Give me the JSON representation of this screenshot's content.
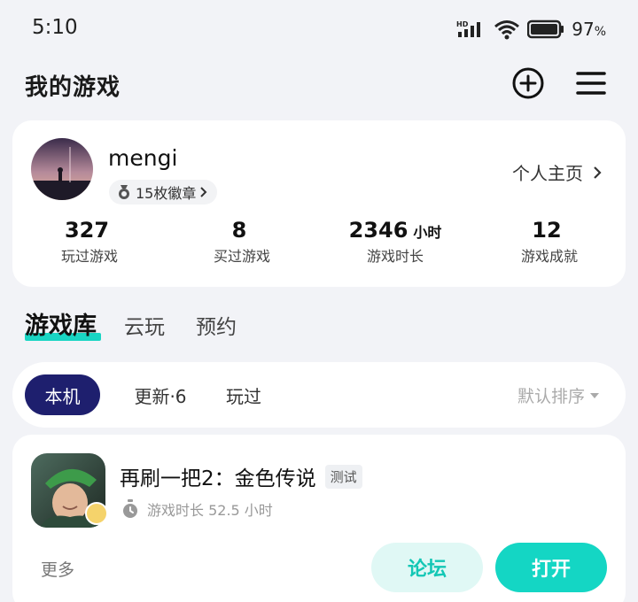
{
  "status_bar": {
    "time": "5:10",
    "network": "HD",
    "battery_percent": "97",
    "battery_unit": "%"
  },
  "header": {
    "title": "我的游戏",
    "add_icon": "add-circle-icon",
    "menu_icon": "menu-icon"
  },
  "profile": {
    "username": "mengi",
    "badges_label": "15枚徽章",
    "home_link": "个人主页",
    "stats": [
      {
        "value": "327",
        "unit": "",
        "label": "玩过游戏"
      },
      {
        "value": "8",
        "unit": "",
        "label": "买过游戏"
      },
      {
        "value": "2346",
        "unit": "小时",
        "label": "游戏时长"
      },
      {
        "value": "12",
        "unit": "",
        "label": "游戏成就"
      }
    ]
  },
  "tabs": [
    {
      "label": "游戏库",
      "active": true
    },
    {
      "label": "云玩",
      "active": false
    },
    {
      "label": "预约",
      "active": false
    }
  ],
  "filters": {
    "chips": [
      {
        "label": "本机",
        "active": true
      },
      {
        "label": "更新·6",
        "active": false
      },
      {
        "label": "玩过",
        "active": false
      }
    ],
    "sort_label": "默认排序"
  },
  "game": {
    "title": "再刷一把2：金色传说",
    "tag": "测试",
    "playtime": "游戏时长 52.5 小时",
    "more_label": "更多",
    "forum_label": "论坛",
    "open_label": "打开"
  },
  "colors": {
    "accent": "#14d6c4",
    "accent_light": "#e0f8f5",
    "chip_active": "#1e1f6e",
    "background": "#f2f3f7"
  }
}
